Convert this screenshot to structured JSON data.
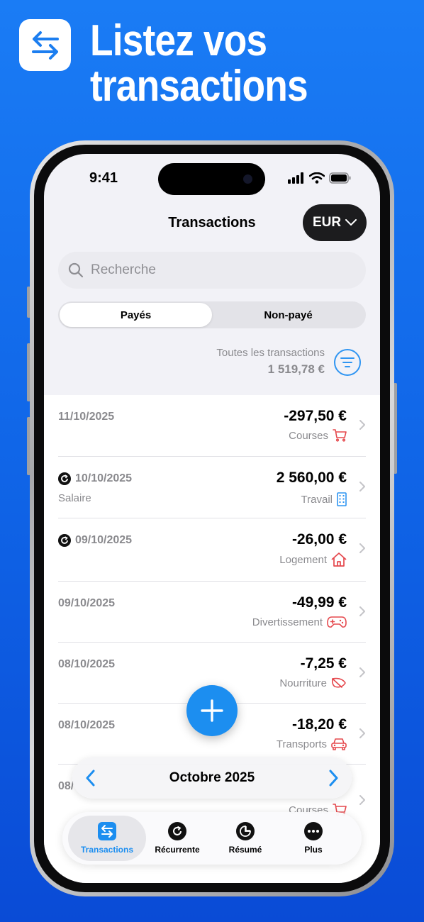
{
  "hero": {
    "title_line1": "Listez vos",
    "title_line2": "transactions",
    "icon": "swap-arrows-icon"
  },
  "status_bar": {
    "time": "9:41"
  },
  "header": {
    "title": "Transactions",
    "currency": "EUR"
  },
  "search": {
    "placeholder": "Recherche",
    "value": ""
  },
  "segment": {
    "options": [
      "Payés",
      "Non-payé"
    ],
    "selected": "Payés"
  },
  "totals": {
    "label": "Toutes les transactions",
    "amount": "1 519,78 €"
  },
  "transactions": [
    {
      "date": "11/10/2025",
      "recurring": false,
      "note": "",
      "amount": "-297,50 €",
      "category": "Courses",
      "category_icon": "cart-icon",
      "category_color": "#e5484d"
    },
    {
      "date": "10/10/2025",
      "recurring": true,
      "note": "Salaire",
      "amount": "2 560,00 €",
      "category": "Travail",
      "category_icon": "building-icon",
      "category_color": "#2f95f2"
    },
    {
      "date": "09/10/2025",
      "recurring": true,
      "note": "",
      "amount": "-26,00 €",
      "category": "Logement",
      "category_icon": "house-icon",
      "category_color": "#e5484d"
    },
    {
      "date": "09/10/2025",
      "recurring": false,
      "note": "",
      "amount": "-49,99 €",
      "category": "Divertissement",
      "category_icon": "gamepad-icon",
      "category_color": "#e5484d"
    },
    {
      "date": "08/10/2025",
      "recurring": false,
      "note": "",
      "amount": "-7,25 €",
      "category": "Nourriture",
      "category_icon": "leaf-icon",
      "category_color": "#e5484d"
    },
    {
      "date": "08/10/2025",
      "recurring": false,
      "note": "",
      "amount": "-18,20 €",
      "category": "Transports",
      "category_icon": "car-icon",
      "category_color": "#e5484d"
    },
    {
      "date": "08/",
      "recurring": false,
      "note": "",
      "amount": "",
      "category": "Courses",
      "category_icon": "cart-icon",
      "category_color": "#e5484d"
    }
  ],
  "month_selector": {
    "label": "Octobre 2025"
  },
  "tabbar": {
    "tabs": [
      {
        "label": "Transactions",
        "icon": "swap-arrows-icon",
        "active": true
      },
      {
        "label": "Récurrente",
        "icon": "recurring-icon",
        "active": false
      },
      {
        "label": "Résumé",
        "icon": "pie-chart-icon",
        "active": false
      },
      {
        "label": "Plus",
        "icon": "more-icon",
        "active": false
      }
    ]
  },
  "colors": {
    "accent": "#1c8ef0",
    "expense": "#e5484d",
    "background": "#1a7cf5"
  }
}
